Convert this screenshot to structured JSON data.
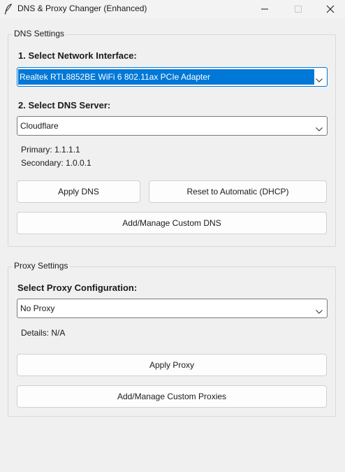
{
  "window": {
    "title": "DNS & Proxy Changer (Enhanced)",
    "app_icon": "feather-icon",
    "controls": [
      "minimize-icon",
      "maximize-icon",
      "close-icon"
    ]
  },
  "dns": {
    "group_label": "DNS Settings",
    "interface_label": "1. Select Network Interface:",
    "interface_value": "Realtek RTL8852BE WiFi 6 802.11ax PCIe Adapter",
    "server_label": "2. Select DNS Server:",
    "server_value": "Cloudflare",
    "primary": "Primary: 1.1.1.1",
    "secondary": "Secondary: 1.0.0.1",
    "apply_label": "Apply DNS",
    "reset_label": "Reset to Automatic (DHCP)",
    "manage_label": "Add/Manage Custom DNS"
  },
  "proxy": {
    "group_label": "Proxy Settings",
    "config_label": "Select Proxy Configuration:",
    "config_value": "No Proxy",
    "details": "Details: N/A",
    "apply_label": "Apply Proxy",
    "manage_label": "Add/Manage Custom Proxies"
  },
  "colors": {
    "selection": "#0078d7",
    "window_bg": "#f0f0f0"
  }
}
